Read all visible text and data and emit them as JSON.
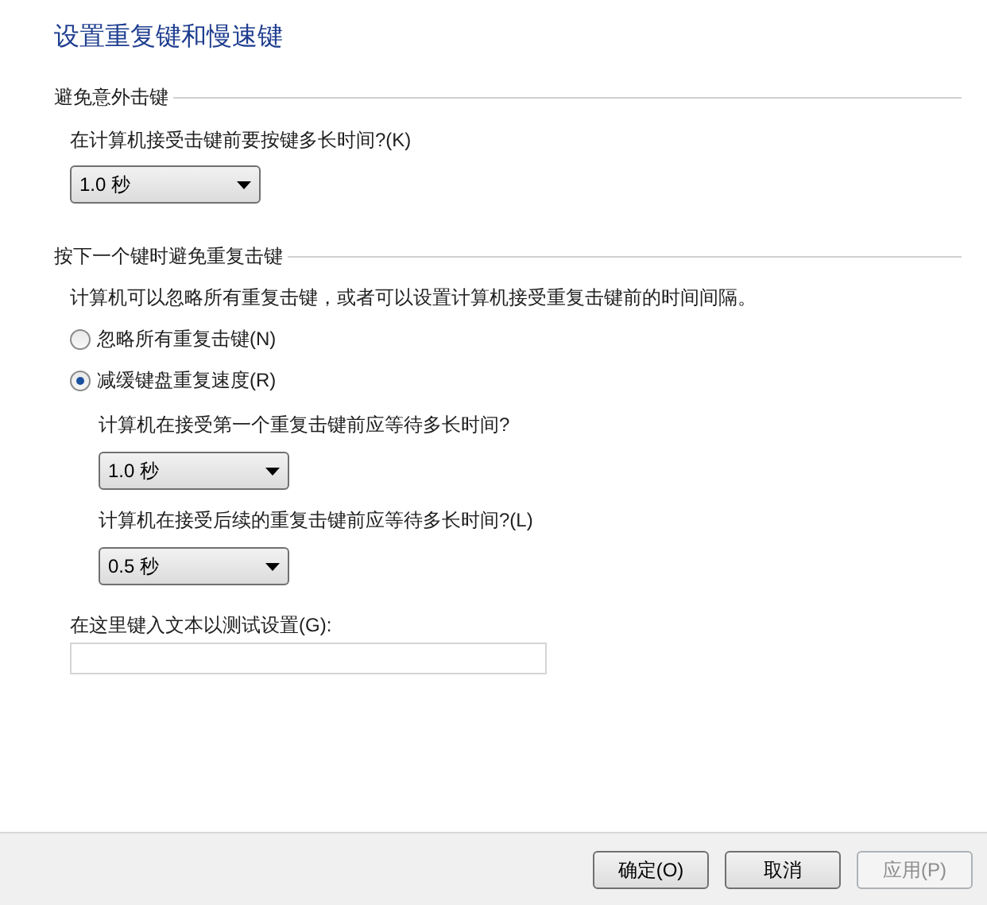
{
  "title": "设置重复键和慢速键",
  "sections": [
    {
      "heading": "避免意外击键",
      "items": [
        {
          "kind": "label",
          "text": "在计算机接受击键前要按键多长时间?(K)"
        },
        {
          "kind": "dropdown",
          "value": "1.0 秒"
        }
      ]
    },
    {
      "heading": "按下一个键时避免重复击键",
      "items": [
        {
          "kind": "text",
          "text": "计算机可以忽略所有重复击键，或者可以设置计算机接受重复击键前的时间间隔。"
        },
        {
          "kind": "radio",
          "text": "忽略所有重复击键(N)",
          "selected": false
        },
        {
          "kind": "radio",
          "text": "减缓键盘重复速度(R)",
          "selected": true
        },
        {
          "kind": "sublabel",
          "text": "计算机在接受第一个重复击键前应等待多长时间?"
        },
        {
          "kind": "subdropdown",
          "value": "1.0 秒"
        },
        {
          "kind": "sublabel",
          "text": "计算机在接受后续的重复击键前应等待多长时间?(L)"
        },
        {
          "kind": "subdropdown",
          "value": "0.5 秒"
        }
      ]
    }
  ],
  "test_field": {
    "label": "在这里键入文本以测试设置(G):"
  },
  "buttons": [
    {
      "label": "确定(O)",
      "disabled": false
    },
    {
      "label": "取消",
      "disabled": false
    },
    {
      "label": "应用(P)",
      "disabled": true
    }
  ]
}
